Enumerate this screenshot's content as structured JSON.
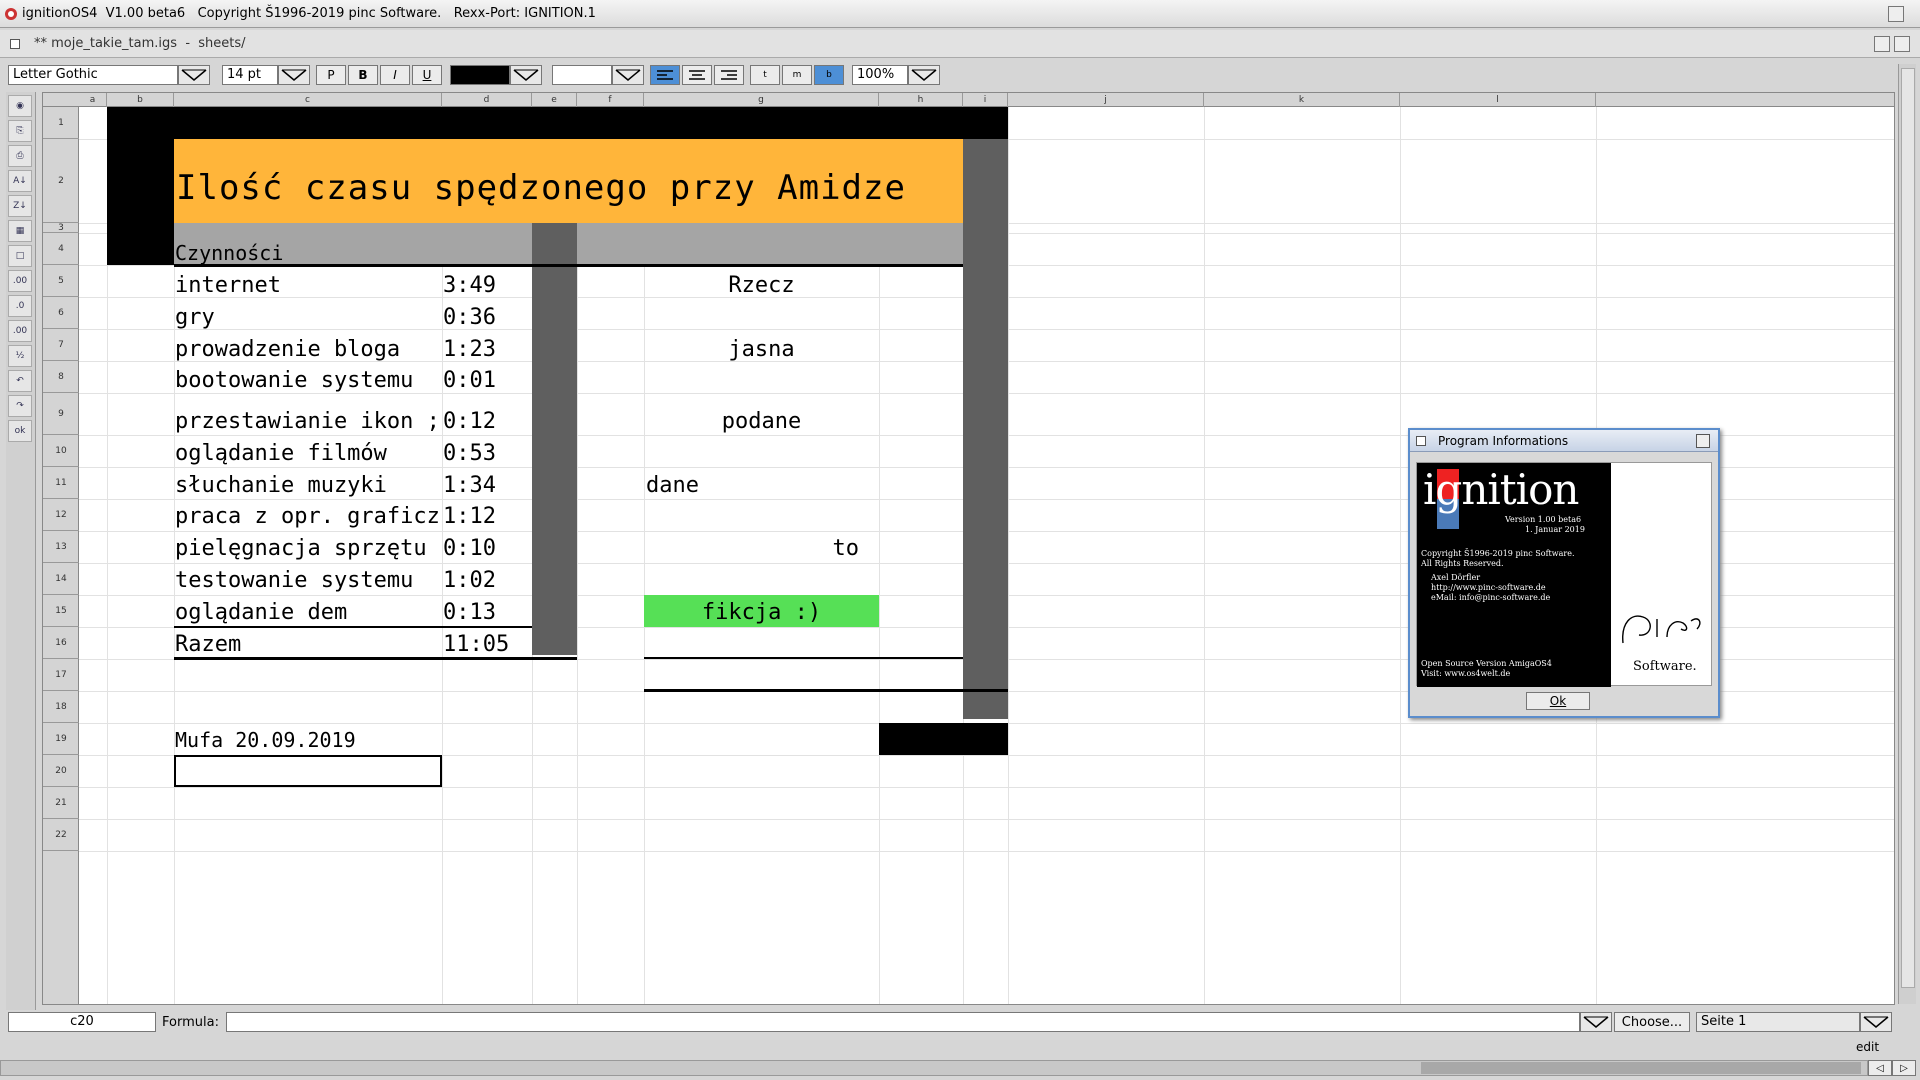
{
  "titlebar": {
    "app_title": "ignitionOS4  V1.00 beta6   Copyright Š1996-2019 pinc Software.   Rexx-Port: IGNITION.1"
  },
  "window": {
    "doc_title": "** moje_takie_tam.igs  -  sheets/"
  },
  "toolbar": {
    "font_name": "Letter Gothic",
    "font_size": "14 pt",
    "style_buttons": [
      "P",
      "B",
      "I",
      "U"
    ],
    "valign_buttons": [
      "t",
      "m",
      "b"
    ],
    "zoom": "100%"
  },
  "columns": [
    "a",
    "b",
    "c",
    "d",
    "e",
    "f",
    "g",
    "h",
    "i",
    "j",
    "k",
    "l"
  ],
  "rows": [
    "1",
    "2",
    "3",
    "4",
    "5",
    "6",
    "7",
    "8",
    "9",
    "10",
    "11",
    "12",
    "13",
    "14",
    "15",
    "16",
    "17",
    "18",
    "19",
    "20",
    "21",
    "22"
  ],
  "sheet": {
    "title": "Ilość czasu spędzonego przy Amidze",
    "header": "Czynności",
    "activities": [
      {
        "name": "internet",
        "time": "3:49"
      },
      {
        "name": "gry",
        "time": "0:36"
      },
      {
        "name": "prowadzenie bloga",
        "time": "1:23"
      },
      {
        "name": "bootowanie systemu",
        "time": "0:01"
      },
      {
        "name": "przestawianie ikon ;",
        "time": "0:12"
      },
      {
        "name": "oglądanie filmów",
        "time": "0:53"
      },
      {
        "name": "słuchanie muzyki",
        "time": "1:34"
      },
      {
        "name": "praca z opr. graficz",
        "time": "1:12"
      },
      {
        "name": "pielęgnacja sprzętu",
        "time": "0:10"
      },
      {
        "name": "testowanie systemu",
        "time": "1:02"
      },
      {
        "name": "oglądanie dem",
        "time": "0:13"
      }
    ],
    "total_label": "Razem",
    "total_time": "11:05",
    "notes": [
      "Rzecz",
      "jasna",
      "podane",
      "dane",
      "to",
      "fikcja :)"
    ],
    "signature": "Mufa 20.09.2019",
    "colors": {
      "title_bg": "#ffb53a",
      "header_bg": "#a5a5a5",
      "dark": "#5f5f5f",
      "green": "#56e056"
    }
  },
  "statusbar": {
    "cell_ref": "c20",
    "formula_label": "Formula:",
    "formula_value": "",
    "choose_label": "Choose...",
    "page_label": "Seite 1",
    "mode": "edit"
  },
  "dialog": {
    "title": "Program Informations",
    "logo": "ignition",
    "version": "Version 1.00 beta6",
    "date": "1. Januar 2019",
    "copyright": "Copyright Š1996-2019 pinc Software.",
    "rights": "All Rights Reserved.",
    "author": "Axel Dörfler",
    "url": "http://www.pinc-software.de",
    "email": "eMail: info@pinc-software.de",
    "open_source": "Open Source Version AmigaOS4",
    "visit": "Visit: www.os4welt.de",
    "company": "Software.",
    "ok_label": "Ok"
  }
}
